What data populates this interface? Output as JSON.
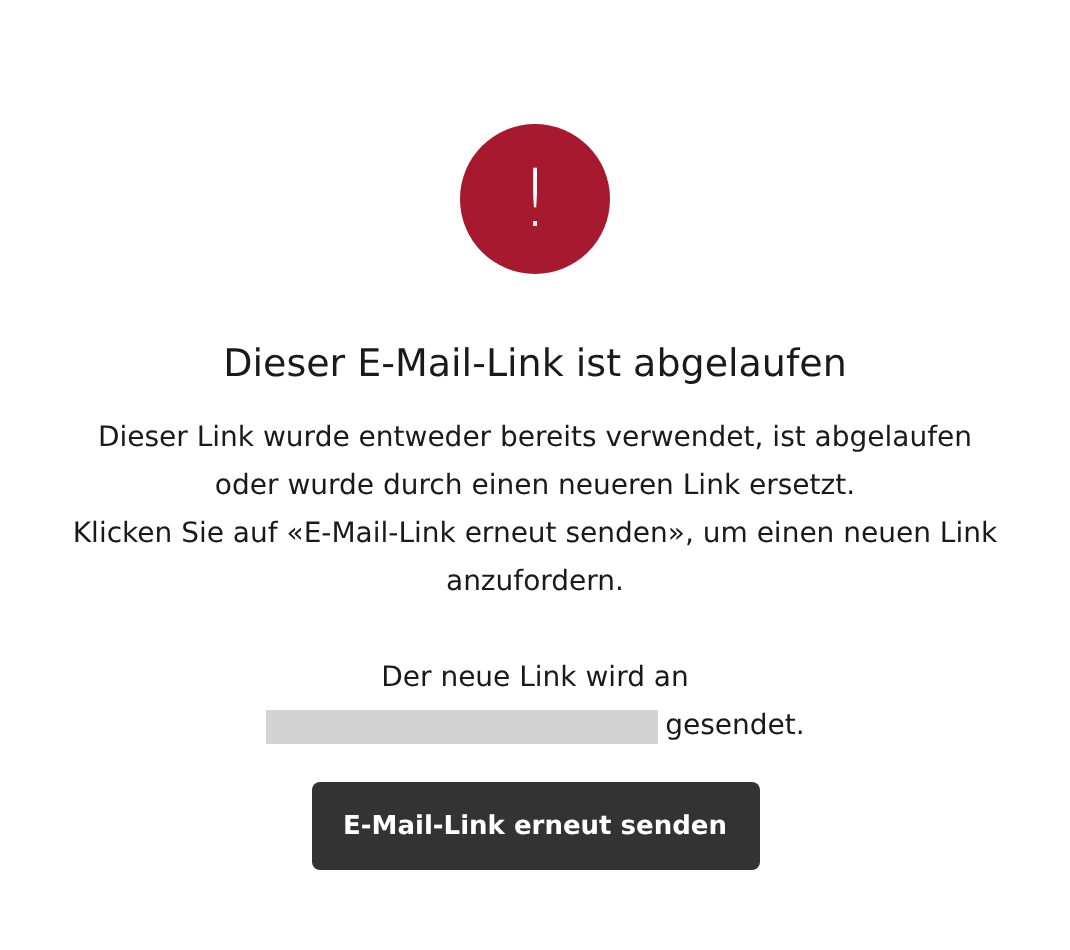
{
  "alert": {
    "icon": "!"
  },
  "title": "Dieser E-Mail-Link ist abgelaufen",
  "paragraphs": [
    "Dieser Link wurde entweder bereits verwendet, ist abgelaufen oder wurde durch einen neueren Link ersetzt.",
    "Klicken Sie auf «E-Mail-Link erneut senden», um einen neuen Link anzufordern."
  ],
  "recipient": {
    "before": "Der neue Link wird an",
    "after": "gesendet."
  },
  "button": {
    "label": "E-Mail-Link erneut senden"
  }
}
